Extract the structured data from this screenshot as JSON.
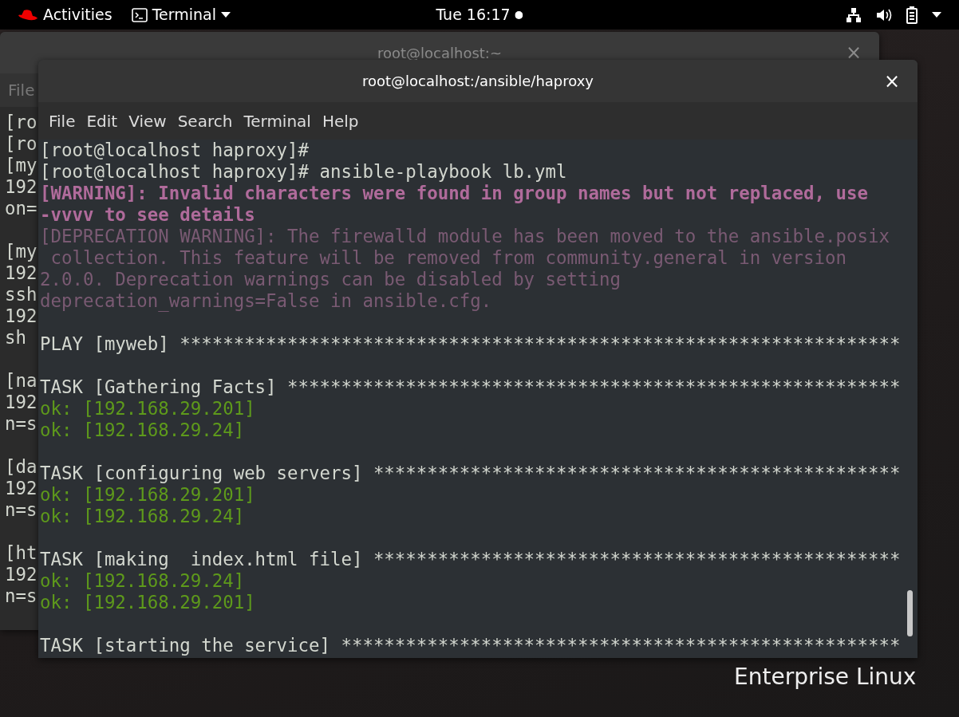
{
  "top_bar": {
    "activities": "Activities",
    "app_menu": "Terminal",
    "clock": "Tue 16:17"
  },
  "back_window": {
    "title": "root@localhost:~",
    "close": "×",
    "menu": [
      "File"
    ],
    "lines": [
      {
        "kind": "normal",
        "text": "[ro"
      },
      {
        "kind": "normal",
        "text": "[ro"
      },
      {
        "kind": "normal",
        "text": "[my"
      },
      {
        "kind": "normal",
        "text": "192"
      },
      {
        "kind": "normal",
        "text": "on="
      },
      {
        "kind": "blank"
      },
      {
        "kind": "normal",
        "text": "[my"
      },
      {
        "kind": "normal",
        "text": "192"
      },
      {
        "kind": "normal",
        "text": "ssh"
      },
      {
        "kind": "normal",
        "text": "192"
      },
      {
        "kind": "normal",
        "text": "sh"
      },
      {
        "kind": "blank"
      },
      {
        "kind": "normal",
        "text": "[na"
      },
      {
        "kind": "normal",
        "text": "192"
      },
      {
        "kind": "normal",
        "text": "n=s"
      },
      {
        "kind": "blank"
      },
      {
        "kind": "normal",
        "text": "[da"
      },
      {
        "kind": "normal",
        "text": "192"
      },
      {
        "kind": "normal",
        "text": "n=s"
      },
      {
        "kind": "blank"
      },
      {
        "kind": "normal",
        "text": "[ht"
      },
      {
        "kind": "normal",
        "text": "192"
      },
      {
        "kind": "normal",
        "text": "n=s"
      }
    ]
  },
  "front_window": {
    "title": "root@localhost:/ansible/haproxy",
    "close": "×",
    "menu": [
      "File",
      "Edit",
      "View",
      "Search",
      "Terminal",
      "Help"
    ],
    "lines": [
      {
        "kind": "normal",
        "text": "[root@localhost haproxy]#"
      },
      {
        "kind": "normal",
        "text": "[root@localhost haproxy]# ansible-playbook lb.yml"
      },
      {
        "kind": "warning",
        "text": "[WARNING]: Invalid characters were found in group names but not replaced, use"
      },
      {
        "kind": "warning",
        "text": "-vvvv to see details"
      },
      {
        "kind": "deprecation",
        "text": "[DEPRECATION WARNING]: The firewalld module has been moved to the ansible.posix"
      },
      {
        "kind": "deprecation",
        "text": " collection. This feature will be removed from community.general in version"
      },
      {
        "kind": "deprecation",
        "text": "2.0.0. Deprecation warnings can be disabled by setting"
      },
      {
        "kind": "deprecation",
        "text": "deprecation_warnings=False in ansible.cfg."
      },
      {
        "kind": "blank"
      },
      {
        "kind": "normal",
        "text": "PLAY [myweb] *******************************************************************"
      },
      {
        "kind": "blank"
      },
      {
        "kind": "normal",
        "text": "TASK [Gathering Facts] *********************************************************"
      },
      {
        "kind": "ok",
        "text": "ok: [192.168.29.201]"
      },
      {
        "kind": "ok",
        "text": "ok: [192.168.29.24]"
      },
      {
        "kind": "blank"
      },
      {
        "kind": "normal",
        "text": "TASK [configuring web servers] *************************************************"
      },
      {
        "kind": "ok",
        "text": "ok: [192.168.29.201]"
      },
      {
        "kind": "ok",
        "text": "ok: [192.168.29.24]"
      },
      {
        "kind": "blank"
      },
      {
        "kind": "normal",
        "text": "TASK [making  index.html file] *************************************************"
      },
      {
        "kind": "ok",
        "text": "ok: [192.168.29.24]"
      },
      {
        "kind": "ok",
        "text": "ok: [192.168.29.201]"
      },
      {
        "kind": "blank"
      },
      {
        "kind": "normal",
        "text": "TASK [starting the service] ****************************************************"
      }
    ]
  },
  "desktop": {
    "brand": "Enterprise Linux"
  }
}
